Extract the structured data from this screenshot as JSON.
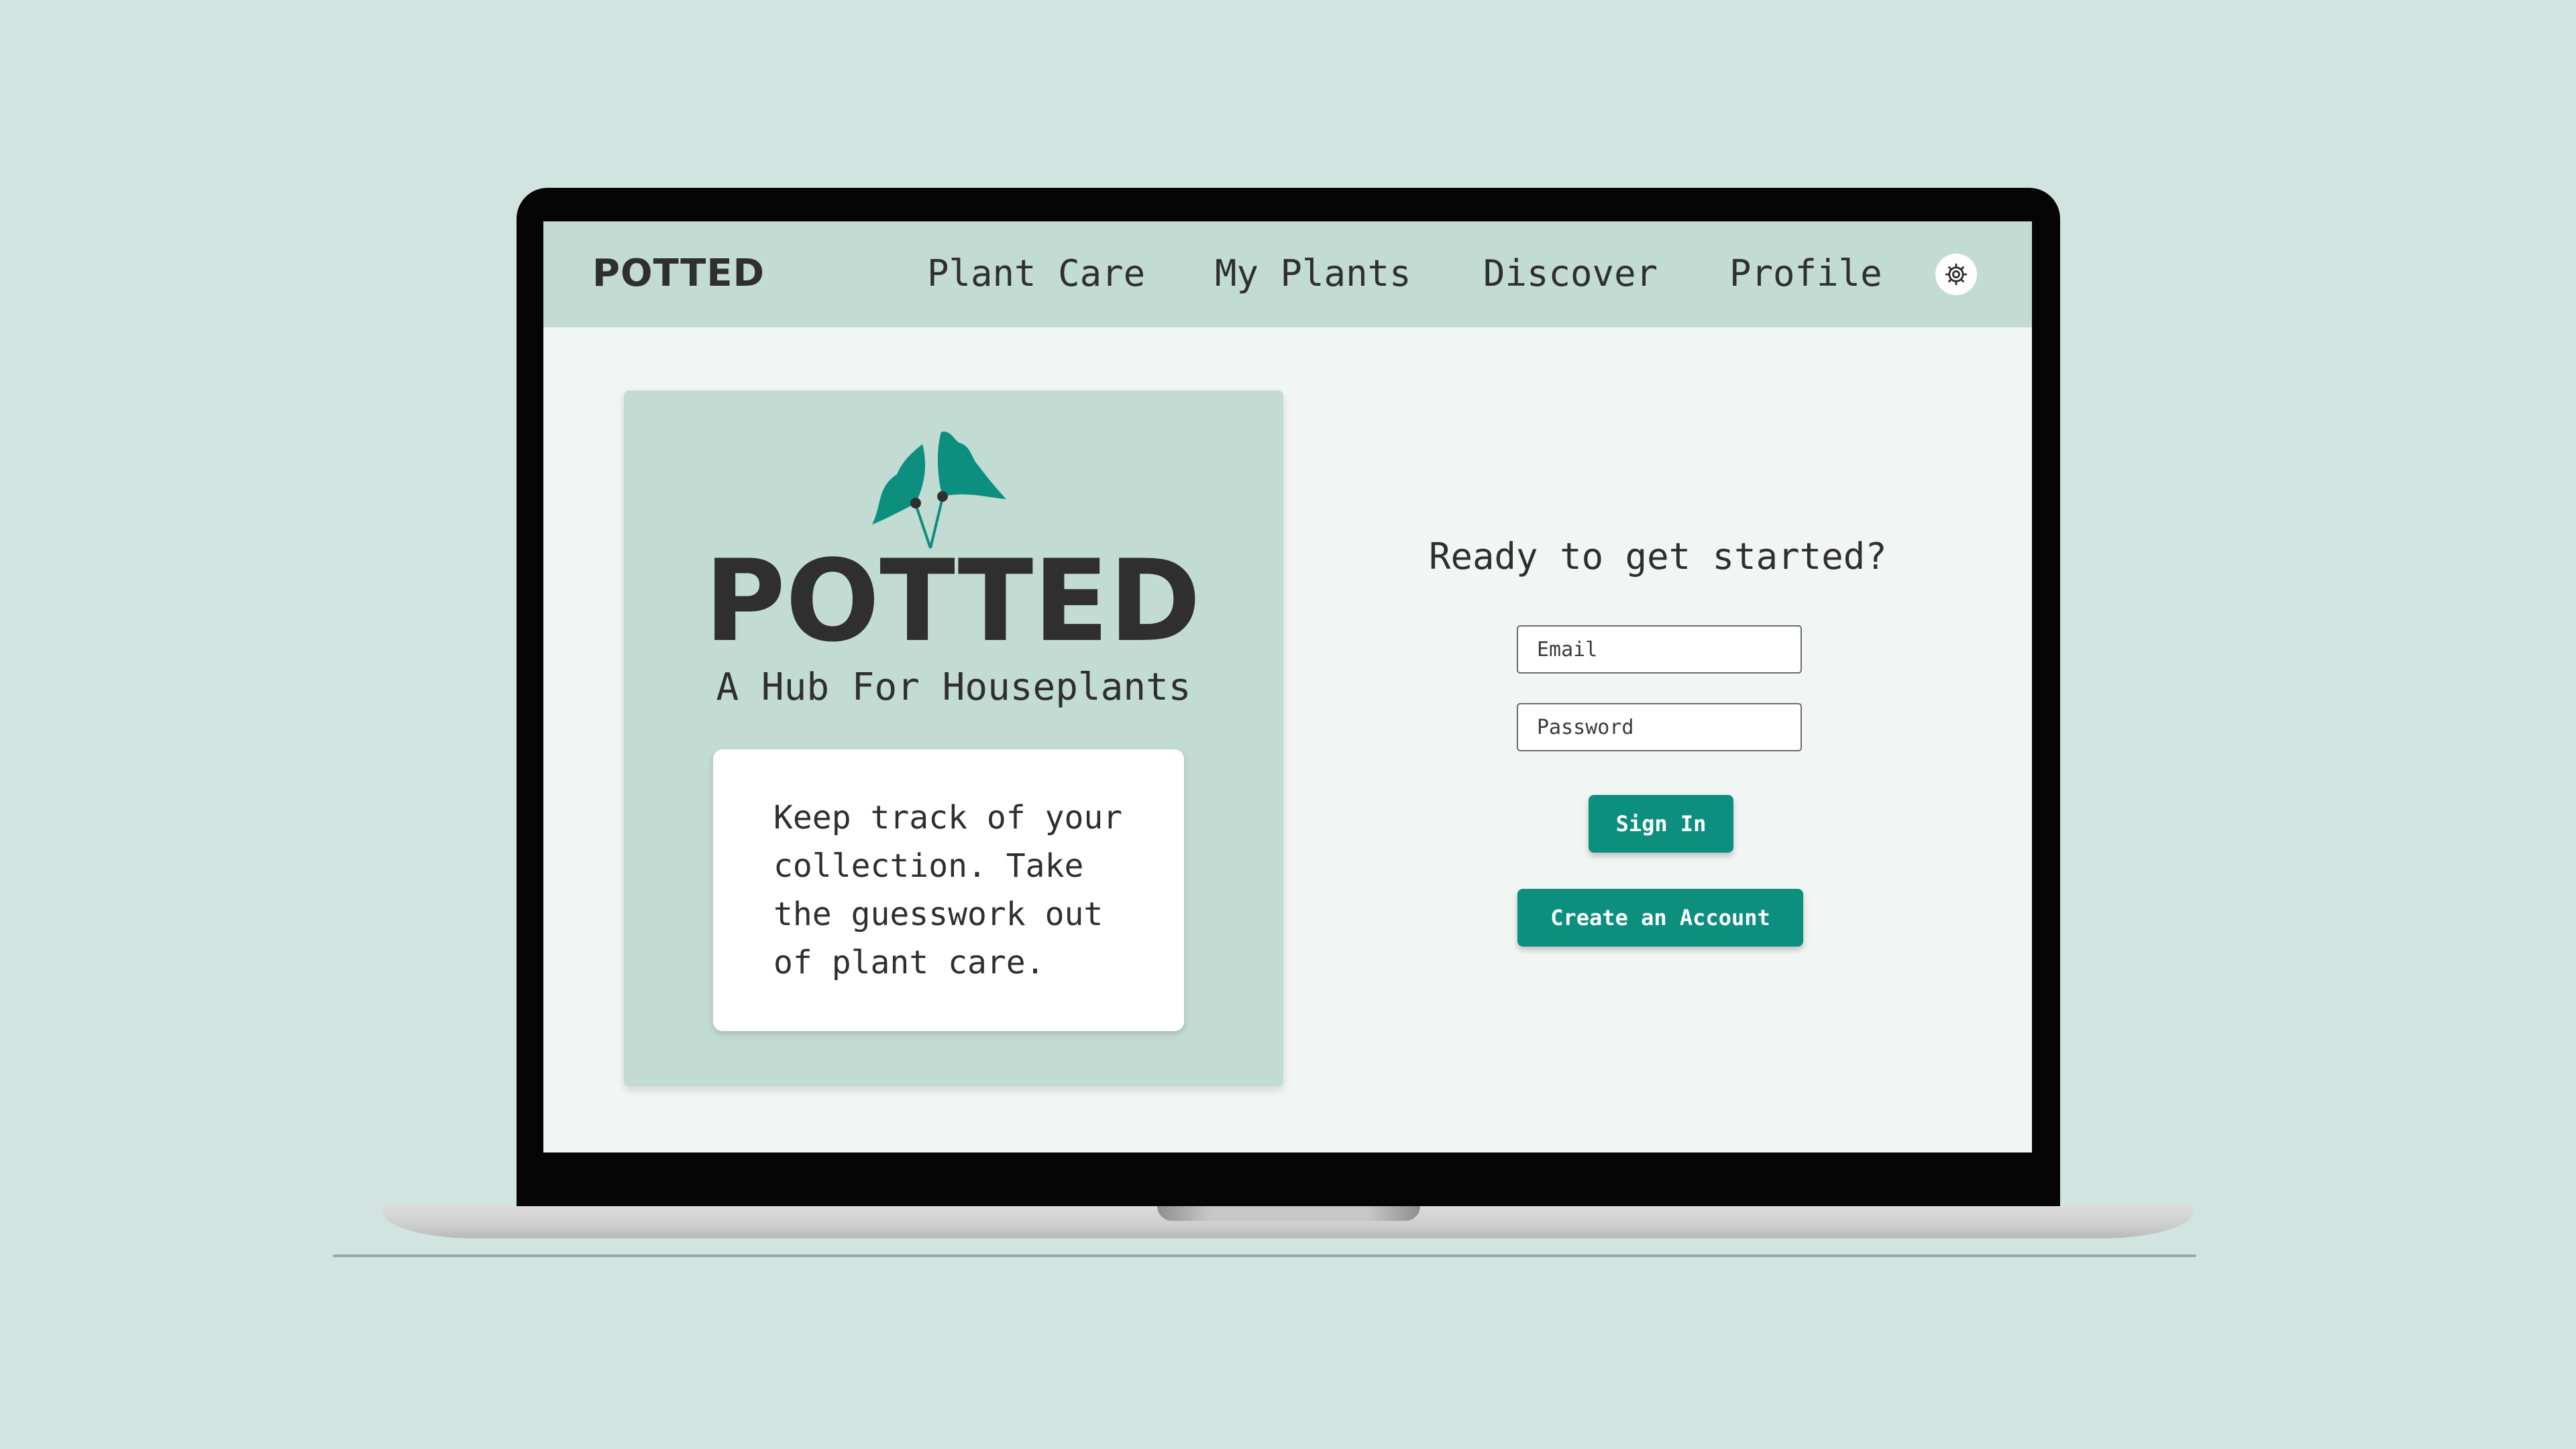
{
  "nav": {
    "brand": "POTTED",
    "links": [
      "Plant Care",
      "My Plants",
      "Discover",
      "Profile"
    ],
    "settings_icon": "gear-icon"
  },
  "hero": {
    "logo_text": "POTTED",
    "tagline": "A Hub For Houseplants",
    "blurb_lines": [
      "Keep track of your",
      "collection. Take",
      "the guesswork out",
      "of plant care."
    ]
  },
  "signin": {
    "heading": "Ready to get started?",
    "email_placeholder": "Email",
    "password_placeholder": "Password",
    "sign_in_label": "Sign In",
    "create_account_label": "Create an Account"
  },
  "colors": {
    "background": "#d1e4df",
    "nav_background": "#c2dbd3",
    "accent": "#0c8f7f",
    "text": "#2f2f2f"
  }
}
